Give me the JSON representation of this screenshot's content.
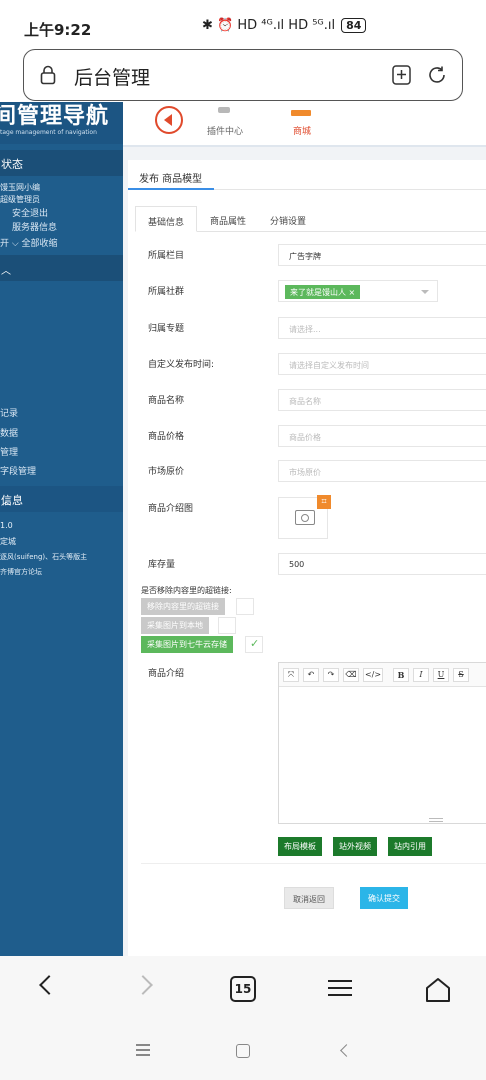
{
  "status_bar": {
    "time": "上午9:22",
    "icons": "✱ ⏰ HD ⁴ᴳ.ıl HD ⁵ᴳ.ıl",
    "battery": "84"
  },
  "browser": {
    "title": "后台管理",
    "tab_count": "15"
  },
  "sidebar": {
    "logo_text": "间管理导航",
    "logo_sub": "tage management of navigation",
    "status_header": "状态",
    "user_lines": [
      "馒玉网小编",
      "超级管理员"
    ],
    "links": [
      "安全退出",
      "服务器信息"
    ],
    "expand_line": "开  ⌵ 全部收缩",
    "menu_items": [
      "记录",
      "数据",
      "管理",
      "字段管理"
    ],
    "info_header": "信息",
    "info_lines": [
      "1.0",
      "定城",
      "逐风(suifeng)、石头等版主",
      "齐博官方论坛"
    ]
  },
  "header": {
    "plugin_label": "插件中心",
    "mall_label": "商城"
  },
  "form": {
    "panel_title": "发布 商品模型",
    "tabs": [
      "基础信息",
      "商品属性",
      "分销设置"
    ],
    "labels": {
      "column": "所属栏目",
      "community": "所属社群",
      "topic": "归属专题",
      "publish_time": "自定义发布时间:",
      "name": "商品名称",
      "price": "商品价格",
      "market_price": "市场原价",
      "intro_image": "商品介绍图",
      "stock": "库存量",
      "remove_links_q": "是否移除内容里的超链接:",
      "intro": "商品介绍"
    },
    "values": {
      "column": "广告字牌",
      "community_tag": "来了就是馒山人",
      "stock": "500"
    },
    "placeholders": {
      "topic": "请选择...",
      "publish_time": "请选择自定义发布时间",
      "name": "商品名称",
      "price": "商品价格",
      "market_price": "市场原价"
    },
    "switches": [
      {
        "label": "移除内容里的超链接",
        "checked": false
      },
      {
        "label": "采集图片到本地",
        "checked": false
      },
      {
        "label": "采集图片到七牛云存储",
        "checked": true
      }
    ],
    "editor_tools": [
      "⤧",
      "↶",
      "↷",
      "⌫",
      "</>",
      "B",
      "I",
      "U",
      "S"
    ],
    "editor_buttons": [
      "布局模板",
      "站外视频",
      "站内引用"
    ],
    "cancel_button": "取消返回",
    "submit_button": "确认提交"
  },
  "colors": {
    "sidebar": "#1f5d8c",
    "accent_green": "#5cb85c",
    "submit": "#2bb5e8",
    "mall_red": "#e04a2c"
  }
}
